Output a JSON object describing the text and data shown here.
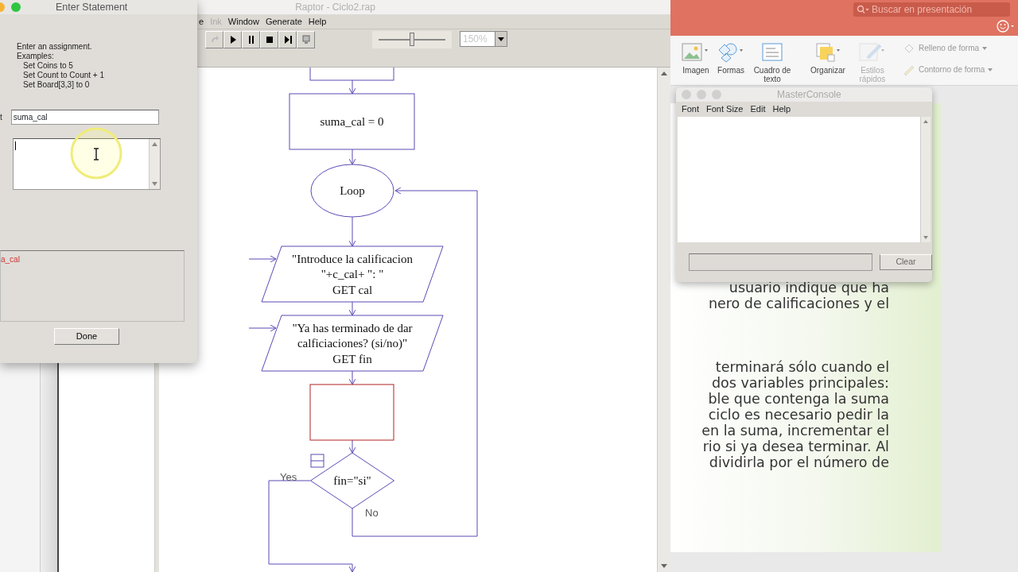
{
  "raptor": {
    "title": "Raptor - Ciclo2.rap",
    "menu": [
      {
        "label": "e",
        "disabled": false
      },
      {
        "label": "Ink",
        "disabled": true
      },
      {
        "label": "Window",
        "disabled": false
      },
      {
        "label": "Generate",
        "disabled": false
      },
      {
        "label": "Help",
        "disabled": false
      }
    ],
    "toolbar": [
      {
        "kind": "redo",
        "disabled": true
      },
      {
        "kind": "play",
        "disabled": false
      },
      {
        "kind": "pause",
        "disabled": false
      },
      {
        "kind": "stop",
        "disabled": false
      },
      {
        "kind": "step",
        "disabled": false
      },
      {
        "kind": "reset",
        "disabled": false
      }
    ],
    "speed_slider": {
      "level": 0.5
    },
    "zoom": {
      "value": "150%",
      "disabled": true
    },
    "flowchart": {
      "nodes": [
        {
          "kind": "assignment",
          "selected": false
        },
        {
          "kind": "assignment",
          "lines": [
            "suma_cal = 0"
          ],
          "selected": false
        },
        {
          "kind": "loop",
          "lines": [
            "Loop"
          ],
          "selected": false
        },
        {
          "kind": "input",
          "lines": [
            "\"Introduce la calificacion",
            "\"+c_cal+ \": \"",
            "GET cal"
          ],
          "selected": false
        },
        {
          "kind": "input",
          "lines": [
            "\"Ya has terminado de dar",
            "calficiaciones? (si/no)\"",
            "GET fin"
          ],
          "selected": false
        },
        {
          "kind": "assignment",
          "selected": true
        },
        {
          "kind": "decision",
          "lines": [
            "fin=\"si\""
          ],
          "yes_label": "Yes",
          "no_label": "No",
          "selected": false
        }
      ]
    }
  },
  "enter_statement": {
    "title": "Enter Statement",
    "help_lines": [
      "Enter an assignment.",
      "Examples:",
      "Set Coins to 5",
      "Set Count to Count + 1",
      "Set Board[3,3] to 0"
    ],
    "set_label": "t",
    "set_field": {
      "value": "suma_cal"
    },
    "message": "a_cal",
    "done_button": "Done"
  },
  "powerpoint": {
    "search": {
      "placeholder": "Buscar en presentación"
    },
    "ribbon": [
      {
        "kind": "picture",
        "label": "Imagen",
        "disabled": false
      },
      {
        "kind": "shapes",
        "label": "Formas",
        "disabled": false
      },
      {
        "kind": "textbox",
        "label": "Cuadro de texto",
        "disabled": false
      },
      {
        "kind": "arrange",
        "label": "Organizar",
        "disabled": false
      },
      {
        "kind": "styles",
        "label": "Estilos rápidos",
        "disabled": true
      }
    ],
    "format": [
      {
        "kind": "fill",
        "label": "Relleno de forma",
        "disabled": true
      },
      {
        "kind": "outline",
        "label": "Contorno de forma",
        "disabled": true
      }
    ],
    "slide_paragraphs": [
      [
        "usuario indique que ha",
        "nero de calificaciones y el"
      ],
      [
        "terminará sólo cuando el",
        "dos variables principales:",
        "ble que contenga la suma",
        "ciclo es necesario pedir la",
        "en la suma, incrementar el",
        "rio si ya desea terminar. Al",
        "dividirla por el número de"
      ]
    ]
  },
  "master_console": {
    "title": "MasterConsole",
    "menu": [
      "Font",
      "Font Size",
      "Edit",
      "Help"
    ],
    "clear_button": "Clear"
  }
}
